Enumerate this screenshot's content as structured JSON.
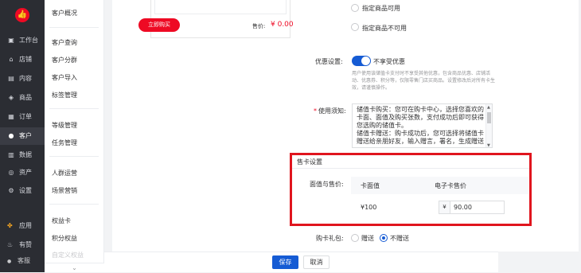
{
  "nav": {
    "logo_icon": "thumb-logo-icon",
    "items": [
      {
        "label": "工作台",
        "icon": "▣"
      },
      {
        "label": "店铺",
        "icon": "⌂"
      },
      {
        "label": "内容",
        "icon": "▤"
      },
      {
        "label": "商品",
        "icon": "◈"
      },
      {
        "label": "订单",
        "icon": "▦"
      },
      {
        "label": "客户",
        "icon": "●"
      },
      {
        "label": "数据",
        "icon": "▥"
      },
      {
        "label": "资产",
        "icon": "◎"
      },
      {
        "label": "设置",
        "icon": "⚙"
      }
    ],
    "bottom": [
      {
        "label": "应用",
        "icon": "✤"
      },
      {
        "label": "有赞",
        "icon": "♨"
      },
      {
        "label": "客服",
        "icon": "●"
      }
    ]
  },
  "subnav": {
    "items": [
      "客户概况",
      "客户查询",
      "客户分群",
      "客户导入",
      "标签管理",
      "等级管理",
      "任务管理",
      "人群运营",
      "场景营销",
      "权益卡",
      "积分权益",
      "自定义权益"
    ]
  },
  "preview": {
    "price_label": "售价:",
    "price_value": "¥ 0.00",
    "buy_button": "立即购买"
  },
  "scope": {
    "option1": "指定商品可用",
    "option2": "指定商品不可用"
  },
  "discount": {
    "label": "优惠设置:",
    "switch_text": "不享受优惠",
    "switch_on": true,
    "help": "用户使用该储值卡支付时不享受其他优惠，包含商品优惠、店铺活动、优惠券、积分等，仅限零售门店买商品。设置修改后对所有卡生效，请谨慎操作。"
  },
  "notice": {
    "label": "使用须知:",
    "text": "储值卡购买：您可在购卡中心，选择您喜欢的卡面、面值及购买张数，支付成功后即可获得您选购的储值卡。\n储值卡赠送：购卡成功后，您可选择将储值卡赠送给亲朋好友，输入赠言，署名，生成赠送"
  },
  "sell": {
    "title": "售卡设置",
    "row_label": "面值与售价:",
    "col_face": "卡面值",
    "col_price": "电子卡售价",
    "face_value": "¥100",
    "currency": "¥",
    "price": "90.00"
  },
  "gift": {
    "label": "购卡礼包:",
    "opt_gift": "赠送",
    "opt_none": "不赠送"
  },
  "footer": {
    "save": "保存",
    "cancel": "取消"
  },
  "colors": {
    "brand_red": "#ee0a24",
    "primary_blue": "#155bd4",
    "highlight_red": "#e0151e"
  }
}
